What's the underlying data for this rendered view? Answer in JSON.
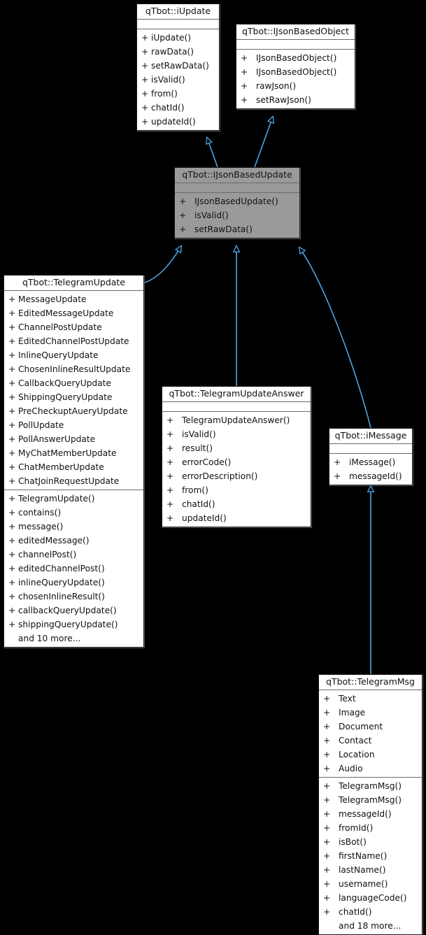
{
  "diagram": {
    "type": "uml-class-inheritance-diagram",
    "background": "#000000",
    "edge_color": "#4fa3e0",
    "highlight_fill": "#9a9a9a"
  },
  "classes": {
    "iUpdate": {
      "title": "qTbot::iUpdate",
      "attributes": [],
      "methods": [
        {
          "vis": "+",
          "name": "iUpdate()"
        },
        {
          "vis": "+",
          "name": "rawData()"
        },
        {
          "vis": "+",
          "name": "setRawData()"
        },
        {
          "vis": "+",
          "name": "isValid()"
        },
        {
          "vis": "+",
          "name": "from()"
        },
        {
          "vis": "+",
          "name": "chatId()"
        },
        {
          "vis": "+",
          "name": "updateId()"
        }
      ]
    },
    "ijsonBasedObject": {
      "title": "qTbot::IJsonBasedObject",
      "attributes": [],
      "methods": [
        {
          "vis": "+",
          "name": "IJsonBasedObject()"
        },
        {
          "vis": "+",
          "name": "IJsonBasedObject()"
        },
        {
          "vis": "+",
          "name": "rawJson()"
        },
        {
          "vis": "+",
          "name": "setRawJson()"
        }
      ]
    },
    "ijsonBasedUpdate": {
      "title": "qTbot::IJsonBasedUpdate",
      "attributes": [],
      "methods": [
        {
          "vis": "+",
          "name": "IJsonBasedUpdate()"
        },
        {
          "vis": "+",
          "name": "isValid()"
        },
        {
          "vis": "+",
          "name": "setRawData()"
        }
      ]
    },
    "telegramUpdate": {
      "title": "qTbot::TelegramUpdate",
      "attributes": [
        {
          "vis": "+",
          "name": "MessageUpdate"
        },
        {
          "vis": "+",
          "name": "EditedMessageUpdate"
        },
        {
          "vis": "+",
          "name": "ChannelPostUpdate"
        },
        {
          "vis": "+",
          "name": "EditedChannelPostUpdate"
        },
        {
          "vis": "+",
          "name": "InlineQueryUpdate"
        },
        {
          "vis": "+",
          "name": "ChosenInlineResultUpdate"
        },
        {
          "vis": "+",
          "name": "CallbackQueryUpdate"
        },
        {
          "vis": "+",
          "name": "ShippingQueryUpdate"
        },
        {
          "vis": "+",
          "name": "PreCheckuptAueryUpdate"
        },
        {
          "vis": "+",
          "name": "PollUpdate"
        },
        {
          "vis": "+",
          "name": "PollAnswerUpdate"
        },
        {
          "vis": "+",
          "name": "MyChatMemberUpdate"
        },
        {
          "vis": "+",
          "name": "ChatMemberUpdate"
        },
        {
          "vis": "+",
          "name": "ChatJoinRequestUpdate"
        }
      ],
      "methods": [
        {
          "vis": "+",
          "name": "TelegramUpdate()"
        },
        {
          "vis": "+",
          "name": "contains()"
        },
        {
          "vis": "+",
          "name": "message()"
        },
        {
          "vis": "+",
          "name": "editedMessage()"
        },
        {
          "vis": "+",
          "name": "channelPost()"
        },
        {
          "vis": "+",
          "name": "editedChannelPost()"
        },
        {
          "vis": "+",
          "name": "inlineQueryUpdate()"
        },
        {
          "vis": "+",
          "name": "chosenInlineResult()"
        },
        {
          "vis": "+",
          "name": "callbackQueryUpdate()"
        },
        {
          "vis": "+",
          "name": "shippingQueryUpdate()"
        },
        {
          "vis": "",
          "name": "and 10 more..."
        }
      ]
    },
    "telegramUpdateAnswer": {
      "title": "qTbot::TelegramUpdateAnswer",
      "attributes": [],
      "methods": [
        {
          "vis": "+",
          "name": "TelegramUpdateAnswer()"
        },
        {
          "vis": "+",
          "name": "isValid()"
        },
        {
          "vis": "+",
          "name": "result()"
        },
        {
          "vis": "+",
          "name": "errorCode()"
        },
        {
          "vis": "+",
          "name": "errorDescription()"
        },
        {
          "vis": "+",
          "name": "from()"
        },
        {
          "vis": "+",
          "name": "chatId()"
        },
        {
          "vis": "+",
          "name": "updateId()"
        }
      ]
    },
    "imessage": {
      "title": "qTbot::iMessage",
      "attributes": [],
      "methods": [
        {
          "vis": "+",
          "name": "iMessage()"
        },
        {
          "vis": "+",
          "name": "messageId()"
        }
      ]
    },
    "telegramMsg": {
      "title": "qTbot::TelegramMsg",
      "attributes": [
        {
          "vis": "+",
          "name": "Text"
        },
        {
          "vis": "+",
          "name": "Image"
        },
        {
          "vis": "+",
          "name": "Document"
        },
        {
          "vis": "+",
          "name": "Contact"
        },
        {
          "vis": "+",
          "name": "Location"
        },
        {
          "vis": "+",
          "name": "Audio"
        }
      ],
      "methods": [
        {
          "vis": "+",
          "name": "TelegramMsg()"
        },
        {
          "vis": "+",
          "name": "TelegramMsg()"
        },
        {
          "vis": "+",
          "name": "messageId()"
        },
        {
          "vis": "+",
          "name": "fromId()"
        },
        {
          "vis": "+",
          "name": "isBot()"
        },
        {
          "vis": "+",
          "name": "firstName()"
        },
        {
          "vis": "+",
          "name": "lastName()"
        },
        {
          "vis": "+",
          "name": "username()"
        },
        {
          "vis": "+",
          "name": "languageCode()"
        },
        {
          "vis": "+",
          "name": "chatId()"
        },
        {
          "vis": "",
          "name": "and 18 more..."
        }
      ]
    }
  },
  "relations": [
    {
      "from": "ijsonBasedUpdate",
      "to": "iUpdate",
      "kind": "inheritance"
    },
    {
      "from": "ijsonBasedUpdate",
      "to": "ijsonBasedObject",
      "kind": "inheritance"
    },
    {
      "from": "telegramUpdate",
      "to": "ijsonBasedUpdate",
      "kind": "inheritance"
    },
    {
      "from": "telegramUpdateAnswer",
      "to": "ijsonBasedUpdate",
      "kind": "inheritance"
    },
    {
      "from": "imessage",
      "to": "ijsonBasedUpdate",
      "kind": "inheritance"
    },
    {
      "from": "telegramMsg",
      "to": "imessage",
      "kind": "inheritance"
    }
  ]
}
